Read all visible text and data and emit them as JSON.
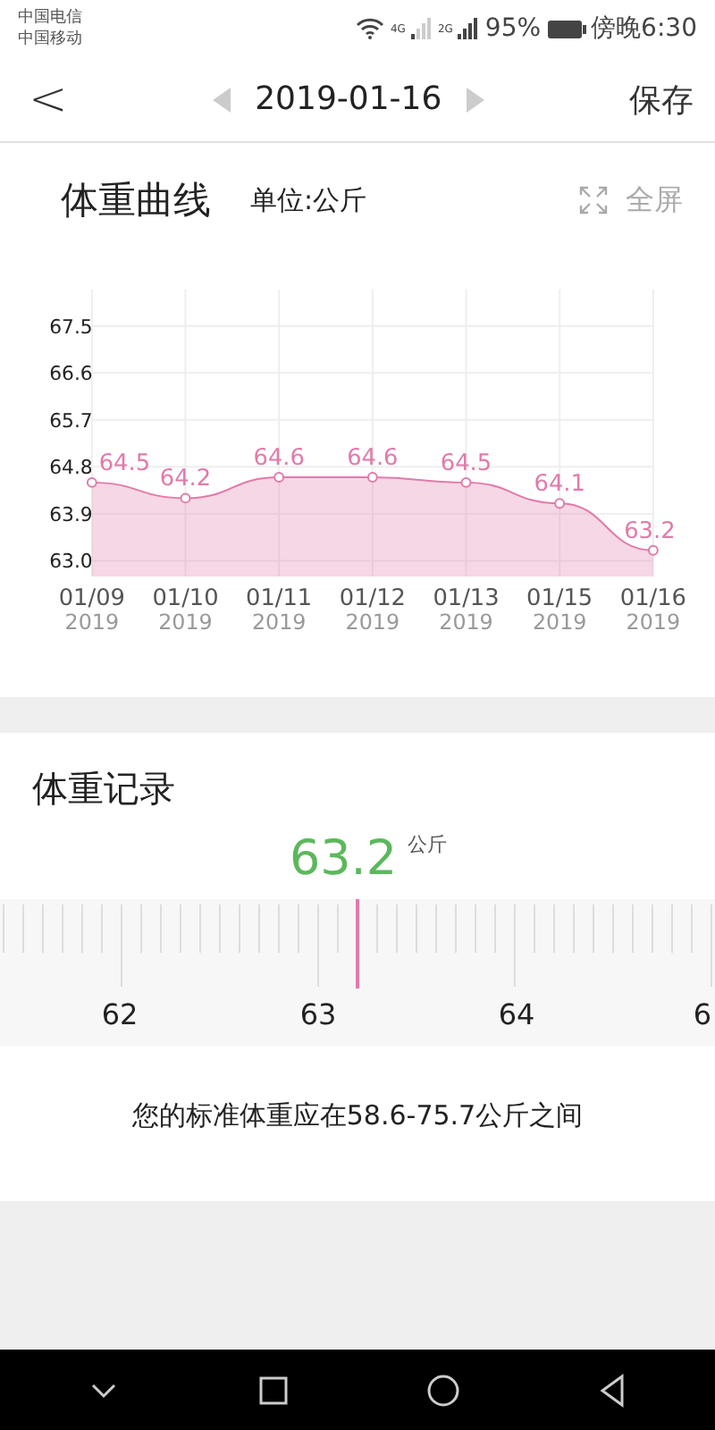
{
  "status_bar": {
    "carriers": [
      "中国电信",
      "中国移动"
    ],
    "sim_1_label": "4G",
    "sim_2_label": "2G",
    "battery": "95%",
    "time": "傍晚6:30"
  },
  "header": {
    "back": "<",
    "date": "2019-01-16",
    "save": "保存"
  },
  "curve_card": {
    "title": "体重曲线",
    "unit": "单位:公斤",
    "fullscreen": "全屏",
    "chart_data": {
      "type": "area",
      "categories": [
        "01/09",
        "01/10",
        "01/11",
        "01/12",
        "01/13",
        "01/15",
        "01/16"
      ],
      "annotations": [
        "2019",
        "2019",
        "2019",
        "2019",
        "2019",
        "2019",
        "2019"
      ],
      "grid": true,
      "series": [
        {
          "color": "#e27aaa",
          "values": [
            64.5,
            64.2,
            64.6,
            64.6,
            64.5,
            64.1,
            63.2
          ]
        }
      ],
      "value_labels": [
        "64.5",
        "64.2",
        "64.6",
        "64.6",
        "64.5",
        "64.1",
        "63.2"
      ],
      "ylim": [
        62.7,
        68.2
      ],
      "yticks": [
        {
          "value": 63.0,
          "label": "63.0"
        },
        {
          "value": 63.9,
          "label": "63.9"
        },
        {
          "value": 64.8,
          "label": "64.8"
        },
        {
          "value": 65.7,
          "label": "65.7"
        },
        {
          "value": 66.6,
          "label": "66.6"
        },
        {
          "value": 67.5,
          "label": "67.5"
        }
      ]
    }
  },
  "record_card": {
    "title": "体重记录",
    "value": "63.2",
    "unit": "公斤",
    "ruler": {
      "level": 0.5,
      "labels": [
        "62",
        "63",
        "64",
        "6"
      ]
    },
    "note": "您的标准体重应在58.6-75.7公斤之间"
  }
}
